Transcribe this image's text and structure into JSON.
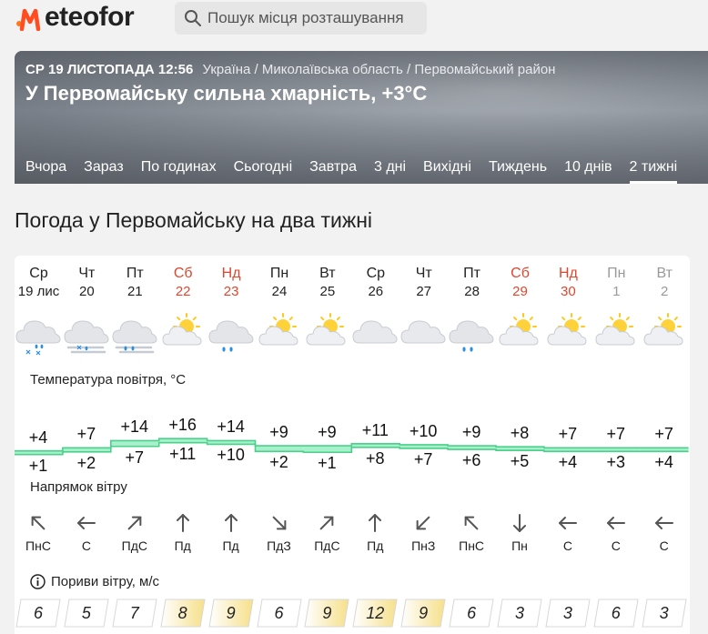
{
  "brand": {
    "name": "eteofor"
  },
  "search": {
    "placeholder": "Пошук місця розташування"
  },
  "hero": {
    "date": "СР 19 ЛИСТОПАДА 12:56",
    "breadcrumb": "Україна / Миколаївська область / Первомайський район",
    "title": "У Первомайську сильна хмарність, +3°C"
  },
  "tabs": [
    "Вчора",
    "Зараз",
    "По годинах",
    "Сьогодні",
    "Завтра",
    "3 дні",
    "Вихідні",
    "Тиждень",
    "10 днів",
    "2 тижні"
  ],
  "active_tab": "2 тижні",
  "section_title": "Погода у Первомайську на два тижні",
  "labels": {
    "temperature": "Температура повітря, °C",
    "wind_direction": "Напрямок вітру",
    "gusts": "Пориви вітру, м/с"
  },
  "days": [
    {
      "name": "Ср",
      "date": "19 лис",
      "kind": "normal",
      "icon": "cloud-snow-icon",
      "max": "+4",
      "min": "+1",
      "wind": "ПнС",
      "gust": "6",
      "gust_level": 0
    },
    {
      "name": "Чт",
      "date": "20",
      "kind": "normal",
      "icon": "cloud-fog-snow-icon",
      "max": "+7",
      "min": "+2",
      "wind": "С",
      "gust": "5",
      "gust_level": 0
    },
    {
      "name": "Пт",
      "date": "21",
      "kind": "normal",
      "icon": "cloud-fog-rain-icon",
      "max": "+14",
      "min": "+7",
      "wind": "ПдС",
      "gust": "7",
      "gust_level": 0
    },
    {
      "name": "Сб",
      "date": "22",
      "kind": "weekend",
      "icon": "sun-cloud-icon",
      "max": "+16",
      "min": "+11",
      "wind": "Пд",
      "gust": "8",
      "gust_level": 1
    },
    {
      "name": "Нд",
      "date": "23",
      "kind": "weekend",
      "icon": "cloud-rain-icon",
      "max": "+14",
      "min": "+10",
      "wind": "Пд",
      "gust": "9",
      "gust_level": 1
    },
    {
      "name": "Пн",
      "date": "24",
      "kind": "normal",
      "icon": "sun-cloud-icon",
      "max": "+9",
      "min": "+2",
      "wind": "ПдЗ",
      "gust": "6",
      "gust_level": 0
    },
    {
      "name": "Вт",
      "date": "25",
      "kind": "normal",
      "icon": "sun-cloud-icon",
      "max": "+9",
      "min": "+1",
      "wind": "ПдС",
      "gust": "9",
      "gust_level": 1
    },
    {
      "name": "Ср",
      "date": "26",
      "kind": "normal",
      "icon": "cloud-icon",
      "max": "+11",
      "min": "+8",
      "wind": "Пд",
      "gust": "12",
      "gust_level": 1
    },
    {
      "name": "Чт",
      "date": "27",
      "kind": "normal",
      "icon": "cloud-icon",
      "max": "+10",
      "min": "+7",
      "wind": "ПнЗ",
      "gust": "9",
      "gust_level": 1
    },
    {
      "name": "Пт",
      "date": "28",
      "kind": "normal",
      "icon": "cloud-rain-icon",
      "max": "+9",
      "min": "+6",
      "wind": "ПнС",
      "gust": "6",
      "gust_level": 0
    },
    {
      "name": "Сб",
      "date": "29",
      "kind": "weekend",
      "icon": "sun-cloud-icon",
      "max": "+8",
      "min": "+5",
      "wind": "Пн",
      "gust": "3",
      "gust_level": 0
    },
    {
      "name": "Нд",
      "date": "30",
      "kind": "weekend",
      "icon": "sun-cloud-icon",
      "max": "+7",
      "min": "+4",
      "wind": "С",
      "gust": "3",
      "gust_level": 0
    },
    {
      "name": "Пн",
      "date": "1",
      "kind": "past",
      "icon": "sun-cloud-icon",
      "max": "+7",
      "min": "+3",
      "wind": "С",
      "gust": "6",
      "gust_level": 0
    },
    {
      "name": "Вт",
      "date": "2",
      "kind": "past",
      "icon": "sun-cloud-icon",
      "max": "+7",
      "min": "+4",
      "wind": "С",
      "gust": "3",
      "gust_level": 0
    }
  ],
  "colors": {
    "accent": "#ff5a1f",
    "weekend": "#e0462e",
    "temp_band": "#a8f0cc",
    "temp_line": "#4ad08a",
    "gust_high": "#f6e08a"
  }
}
